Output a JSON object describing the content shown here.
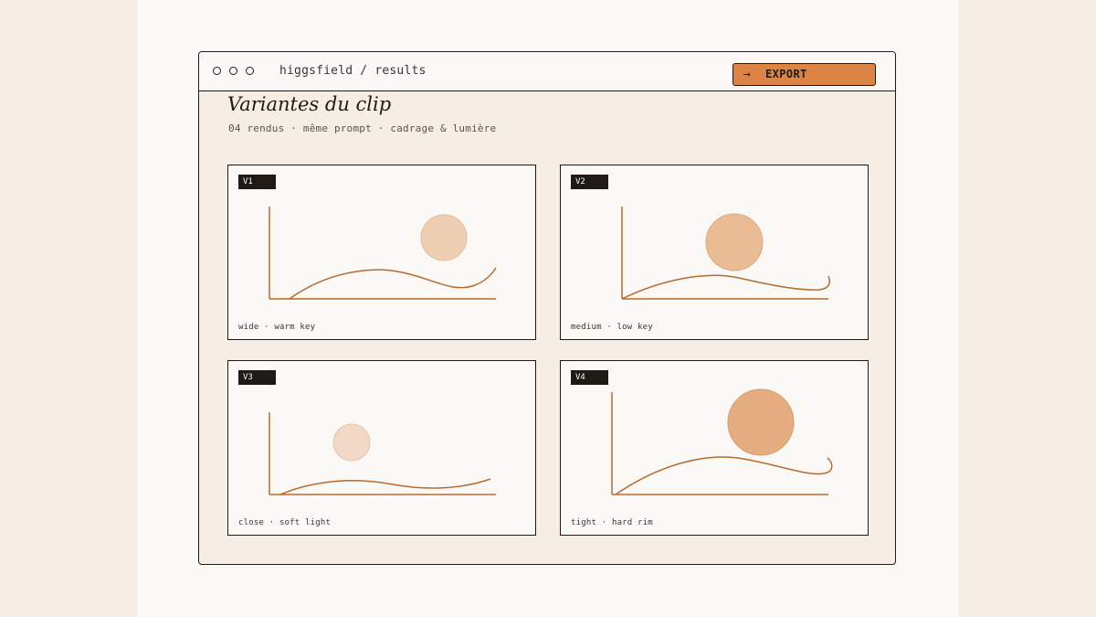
{
  "window": {
    "breadcrumb": "higgsfield / results",
    "export_label": "EXPORT",
    "export_icon": "arrow-right-icon"
  },
  "page": {
    "title": "Variantes du clip",
    "subtitle": "04 rendus · même prompt · cadrage & lumière"
  },
  "variants": [
    {
      "tag": "V1",
      "caption": "wide · warm key"
    },
    {
      "tag": "V2",
      "caption": "medium · low key"
    },
    {
      "tag": "V3",
      "caption": "close · soft light"
    },
    {
      "tag": "V4",
      "caption": "tight · hard rim"
    }
  ],
  "colors": {
    "accent": "#dc8444",
    "ink": "#1f1a16",
    "curve": "#b86a2e"
  }
}
